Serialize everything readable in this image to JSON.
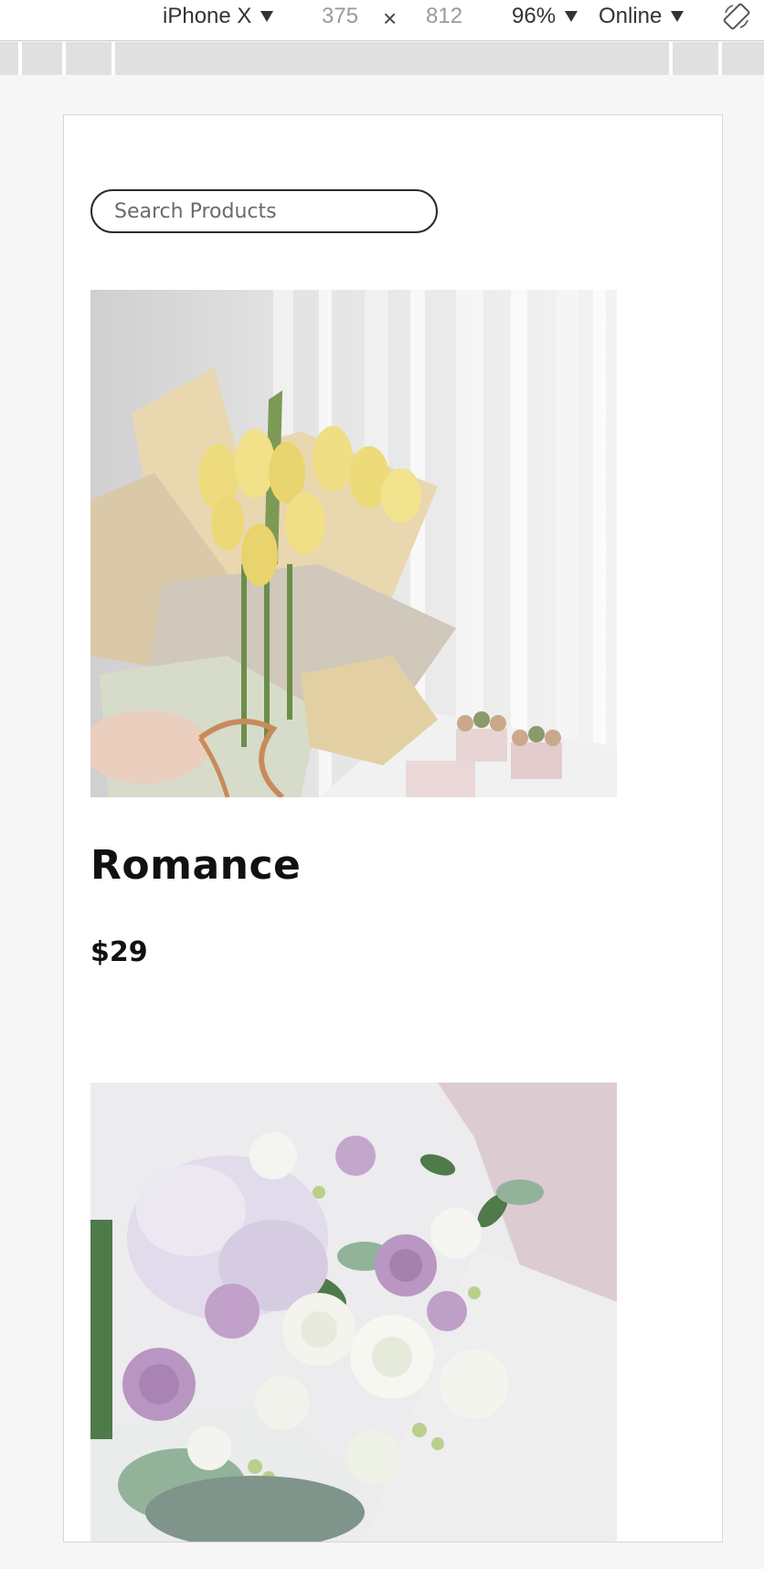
{
  "devtools": {
    "device": "iPhone X",
    "width": "375",
    "times": "×",
    "height": "812",
    "zoom": "96%",
    "network": "Online",
    "rotate_icon": "rotate-device-icon"
  },
  "search": {
    "placeholder": "Search Products"
  },
  "products": [
    {
      "name": "Romance",
      "price": "$29",
      "image_icon": "tulip-bouquet-photo"
    },
    {
      "name": "",
      "price": "",
      "image_icon": "rose-hydrangea-bouquet-photo"
    }
  ],
  "colors": {
    "background": "#f6f6f6",
    "card": "#ffffff",
    "text": "#111111",
    "muted": "#6b6b6b"
  }
}
